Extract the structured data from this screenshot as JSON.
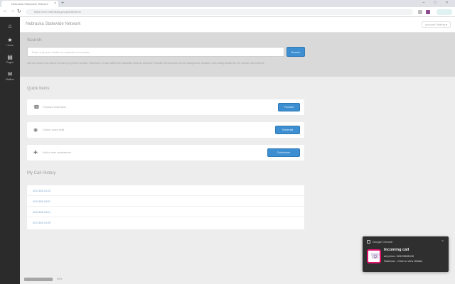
{
  "browser": {
    "tab_title": "Nebraska Statewide Network",
    "tab_close": "×",
    "new_tab": "+",
    "window_controls": "– □ ×",
    "url": "https://nsn.nebraska.gov/portal/home",
    "back": "←",
    "forward": "→",
    "reload": "↻"
  },
  "sidebar": {
    "items": [
      {
        "label": "",
        "icon": "home-icon",
        "glyph": "⌂"
      },
      {
        "label": "Home",
        "icon": "star-icon",
        "glyph": "★"
      },
      {
        "label": "Pages",
        "icon": "file-icon",
        "glyph": "▤"
      },
      {
        "label": "Mailbox",
        "icon": "mail-icon",
        "glyph": "✉"
      }
    ]
  },
  "header": {
    "title": "Nebraska Statewide Network",
    "user_menu": "Account Setting ▾"
  },
  "search": {
    "heading": "Search",
    "placeholder": "Enter a phone number or extension to search...",
    "button": "Search",
    "help": "Use the search box above to look up a phone number, extension, or user within the statewide network directory. Results will show the current assignment, location, and routing details for the number you entered."
  },
  "quick_items": {
    "title": "Quick Items",
    "items": [
      {
        "label": "Forward extension",
        "button": "Forward",
        "icon": "phone-icon",
        "glyph": "☎"
      },
      {
        "label": "Check voice mail",
        "button": "Voicemail",
        "icon": "voicemail-icon",
        "glyph": "◉"
      },
      {
        "label": "Add a new conference",
        "button": "Conference",
        "icon": "conference-icon",
        "glyph": "✚"
      }
    ]
  },
  "recent": {
    "title": "My Call History",
    "links": [
      "402-555-0143",
      "402-555-0187",
      "402-555-0112",
      "402-555-0199"
    ]
  },
  "status": {
    "progress": 0.9,
    "text": "90%"
  },
  "notification": {
    "app": "Google Chrome",
    "close": "×",
    "title": "Incoming call",
    "line1": "ad press: 02693808345",
    "line2": "Rainbow - Click to view details",
    "accent": "#e0146e"
  }
}
